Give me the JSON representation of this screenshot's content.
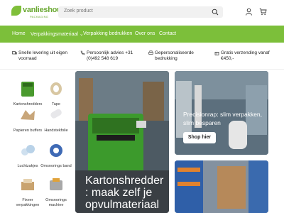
{
  "header": {
    "logo_text": "vanlieshout",
    "logo_sub": "PACKAGING",
    "search_placeholder": "Zoek product"
  },
  "nav": {
    "items": [
      {
        "label": "Home"
      },
      {
        "label": "Verpakkingsmateriaal ⌄"
      },
      {
        "label": "Verpakking bedrukken"
      },
      {
        "label": "Over ons"
      },
      {
        "label": "Contact"
      }
    ]
  },
  "usp": {
    "items": [
      {
        "label": "Snelle levering uit eigen voorraad"
      },
      {
        "label": "Persoonlijk advies +31 (0)492 548 619"
      },
      {
        "label": "Gepersonaliseerde bedrukking"
      },
      {
        "label": "Gratis verzending vanaf €450,-"
      }
    ]
  },
  "sidebar": {
    "items": [
      {
        "label": "Kartonshredders"
      },
      {
        "label": "Tape"
      },
      {
        "label": "Papieren buffers"
      },
      {
        "label": "Handstekfolie"
      },
      {
        "label": "Luchtzakjes"
      },
      {
        "label": "Omsnorings band"
      },
      {
        "label": "Fixeer verpakkingen"
      },
      {
        "label": "Omsnorings machine"
      }
    ]
  },
  "hero": {
    "title": "Kartonshredder : maak zelf je opvulmateriaal"
  },
  "promo": {
    "title": "Precisionrap: slim verpakken, slim besparen",
    "button": "Shop hier"
  },
  "colors": {
    "brand_green": "#7cbf3a",
    "search_bg": "#f1f1f1"
  }
}
